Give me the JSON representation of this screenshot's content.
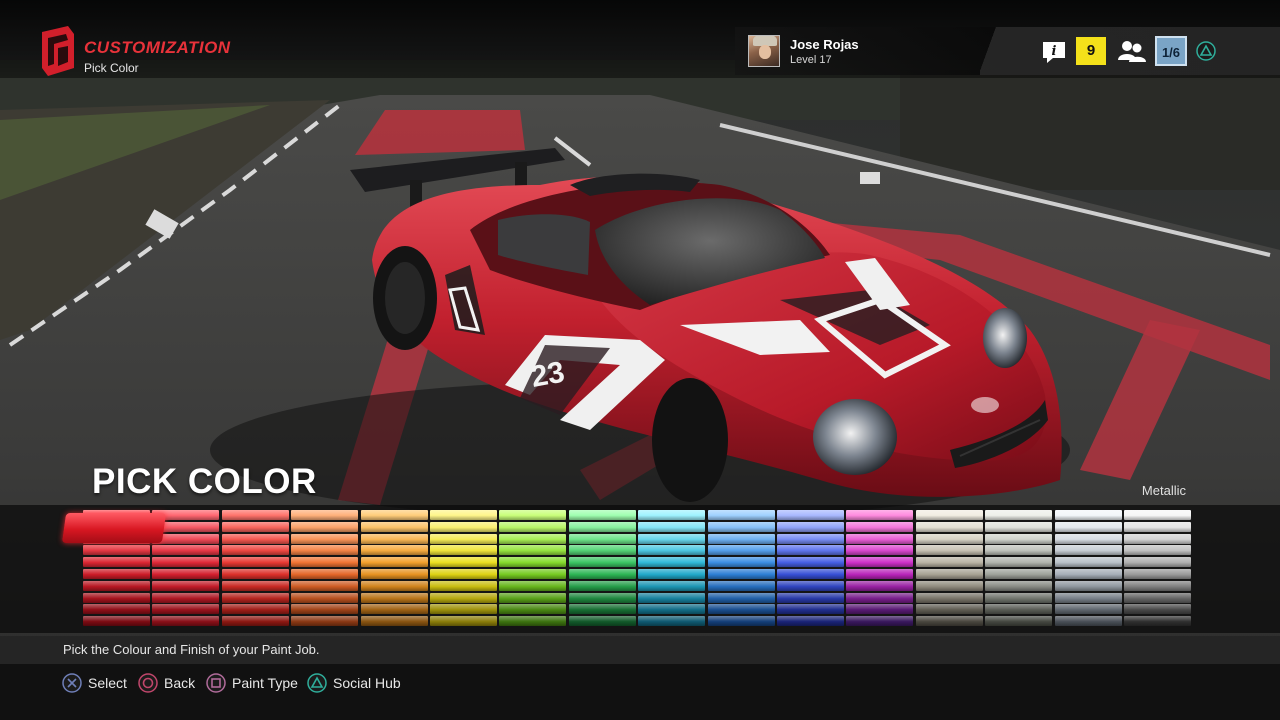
{
  "header": {
    "menu_title": "Customization",
    "menu_subtitle": "Pick Color",
    "player_name": "Jose Rojas",
    "player_level": "Level 17",
    "level_badge": "9",
    "social_count": "1/6",
    "accent_color": "#e8323a"
  },
  "main": {
    "section_title": "Pick Color",
    "finish_type": "Metallic",
    "car_number": "23"
  },
  "palette": {
    "columns": [
      {
        "name": "red-1",
        "top": "#ff6a72",
        "base": "#d61d2a",
        "dark": "#7d0b13"
      },
      {
        "name": "red-2",
        "top": "#ff6670",
        "base": "#dc2030",
        "dark": "#8a0f18"
      },
      {
        "name": "red-3",
        "top": "#ff726a",
        "base": "#e6322c",
        "dark": "#8e1812"
      },
      {
        "name": "orange-1",
        "top": "#ffb07a",
        "base": "#ef6c2a",
        "dark": "#8c3914"
      },
      {
        "name": "orange-2",
        "top": "#ffcd7a",
        "base": "#f29a22",
        "dark": "#8b5511"
      },
      {
        "name": "yellow",
        "top": "#fff58a",
        "base": "#e8dd13",
        "dark": "#8c7e0a"
      },
      {
        "name": "lime",
        "top": "#c9ff7a",
        "base": "#7cd622",
        "dark": "#3d7410"
      },
      {
        "name": "green",
        "top": "#9fffb0",
        "base": "#2fbf59",
        "dark": "#125a2a"
      },
      {
        "name": "cyan",
        "top": "#9ff2ff",
        "base": "#22b2d4",
        "dark": "#0f5a72"
      },
      {
        "name": "blue-1",
        "top": "#9fd1ff",
        "base": "#2f86e0",
        "dark": "#143f7a"
      },
      {
        "name": "blue-2",
        "top": "#a8b8ff",
        "base": "#3a54e2",
        "dark": "#1a2478"
      },
      {
        "name": "purple",
        "top": "#ff8adf",
        "base": "#c825c6",
        "dark": "#3a185e"
      },
      {
        "name": "silver-1",
        "top": "#f1ede2",
        "base": "#b3ad9d",
        "dark": "#4a473f"
      },
      {
        "name": "silver-2",
        "top": "#eef0ea",
        "base": "#a9ada5",
        "dark": "#454841"
      },
      {
        "name": "silver-3",
        "top": "#f2f6fa",
        "base": "#b2bac3",
        "dark": "#4a5058"
      },
      {
        "name": "grey",
        "top": "#f6f6f6",
        "base": "#a7a7a7",
        "dark": "#303030"
      }
    ]
  },
  "footer": {
    "hint": "Pick the Colour and Finish of your Paint Job.",
    "prompts": [
      {
        "button": "cross",
        "color": "#6f7fb8",
        "label": "Select"
      },
      {
        "button": "circle",
        "color": "#c0466b",
        "label": "Back"
      },
      {
        "button": "square",
        "color": "#b06b9a",
        "label": "Paint Type"
      },
      {
        "button": "triangle",
        "color": "#2fae9b",
        "label": "Social Hub"
      }
    ]
  }
}
